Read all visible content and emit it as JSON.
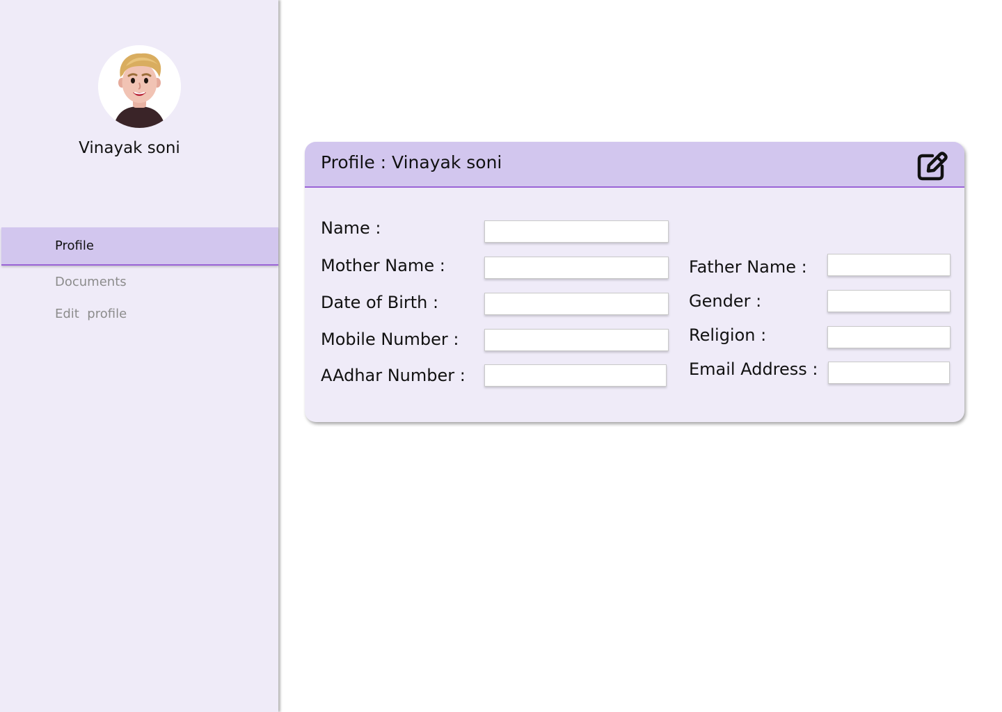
{
  "sidebar": {
    "user_name": "Vinayak soni",
    "nav": {
      "active": "Profile",
      "items": [
        "Documents",
        "Edit  profile"
      ]
    }
  },
  "card": {
    "title": "Profile : Vinayak soni",
    "edit_icon": "edit-icon",
    "fields": {
      "name": {
        "label": "Name :",
        "value": ""
      },
      "mother_name": {
        "label": "Mother Name :",
        "value": ""
      },
      "dob": {
        "label": "Date of Birth :",
        "value": ""
      },
      "mobile": {
        "label": "Mobile Number :",
        "value": ""
      },
      "aadhar": {
        "label": "AAdhar Number :",
        "value": ""
      },
      "father_name": {
        "label": "Father Name :",
        "value": ""
      },
      "gender": {
        "label": "Gender :",
        "value": ""
      },
      "religion": {
        "label": "Religion :",
        "value": ""
      },
      "email": {
        "label": "Email Address :",
        "value": ""
      }
    }
  },
  "colors": {
    "sidebar_bg": "#efebf8",
    "accent_bg": "#d2c6ee",
    "accent_line": "#9a63d6"
  }
}
